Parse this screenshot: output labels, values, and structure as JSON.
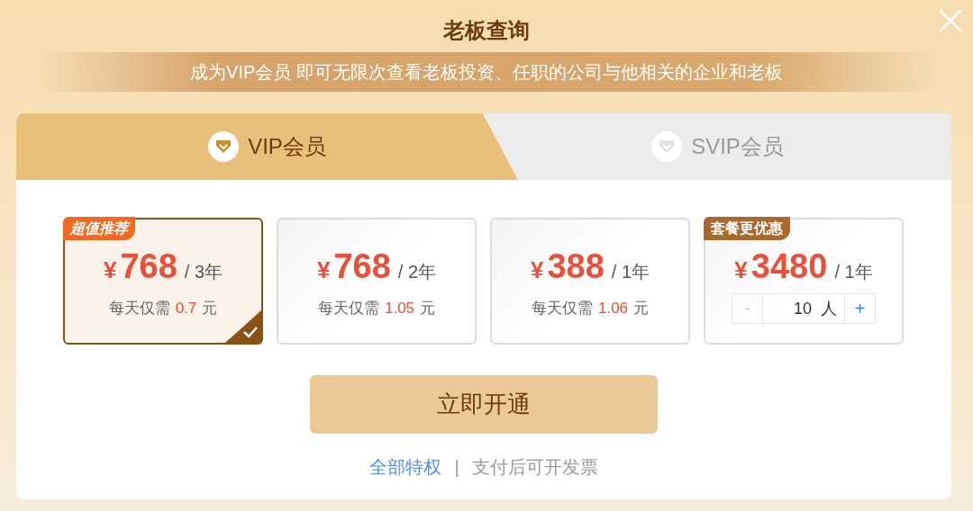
{
  "dialog": {
    "title": "老板查询",
    "banner": "成为VIP会员 即可无限次查看老板投资、任职的公司与他相关的企业和老板"
  },
  "tabs": [
    {
      "label": "VIP会员",
      "selected": true
    },
    {
      "label": "SVIP会员",
      "selected": false
    }
  ],
  "plans": [
    {
      "kind": "daily",
      "badge": {
        "text": "超值推荐",
        "color": "#f06a24"
      },
      "currency": "¥",
      "price": "768",
      "period": "/ 3年",
      "per_day_label": "每天仅需",
      "per_day_amount": "0.7",
      "per_day_unit": "元",
      "selected": true
    },
    {
      "kind": "daily",
      "currency": "¥",
      "price": "768",
      "period": "/ 2年",
      "per_day_label": "每天仅需",
      "per_day_amount": "1.05",
      "per_day_unit": "元",
      "selected": false
    },
    {
      "kind": "daily",
      "currency": "¥",
      "price": "388",
      "period": "/ 1年",
      "per_day_label": "每天仅需",
      "per_day_amount": "1.06",
      "per_day_unit": "元",
      "selected": false
    },
    {
      "kind": "stepper",
      "badge": {
        "text": "套餐更优惠",
        "color": "#a8692c"
      },
      "currency": "¥",
      "price": "3480",
      "period": "/ 1年",
      "stepper": {
        "minus": "-",
        "value": "10",
        "unit": "人",
        "plus": "+"
      },
      "selected": false
    }
  ],
  "primary_button": "立即开通",
  "footer": {
    "link": "全部特权",
    "separator": "|",
    "note": "支付后可开发票"
  }
}
